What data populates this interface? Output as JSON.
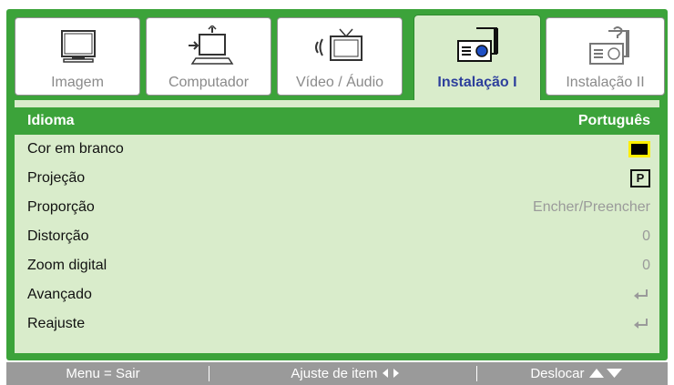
{
  "tabs": [
    {
      "label": "Imagem",
      "icon": "monitor-icon",
      "active": false
    },
    {
      "label": "Computador",
      "icon": "computer-icon",
      "active": false
    },
    {
      "label": "Vídeo / Áudio",
      "icon": "video-audio-icon",
      "active": false
    },
    {
      "label": "Instalação I",
      "icon": "projector-icon",
      "active": true
    },
    {
      "label": "Instalação II",
      "icon": "projector-settings-icon",
      "active": false
    }
  ],
  "menu": {
    "rows": [
      {
        "label": "Idioma",
        "value": "Português",
        "selected": true
      },
      {
        "label": "Cor em branco",
        "value_icon": "black-swatch-icon"
      },
      {
        "label": "Projeção",
        "value_icon": "front-projection-icon",
        "value_icon_text": "P"
      },
      {
        "label": "Proporção",
        "value": "Encher/Preencher"
      },
      {
        "label": "Distorção",
        "value": "0"
      },
      {
        "label": "Zoom digital",
        "value": "0"
      },
      {
        "label": "Avançado",
        "value_icon": "enter-icon"
      },
      {
        "label": "Reajuste",
        "value_icon": "enter-icon"
      }
    ]
  },
  "footer": {
    "exit": "Menu = Sair",
    "adjust": "Ajuste de item",
    "move": "Deslocar"
  },
  "colors": {
    "accent": "#3ca33a",
    "panel": "#d9eccb",
    "active_tab_text": "#2d3f9c",
    "footer": "#9a9a9a",
    "swatch_border": "#ffee00"
  }
}
